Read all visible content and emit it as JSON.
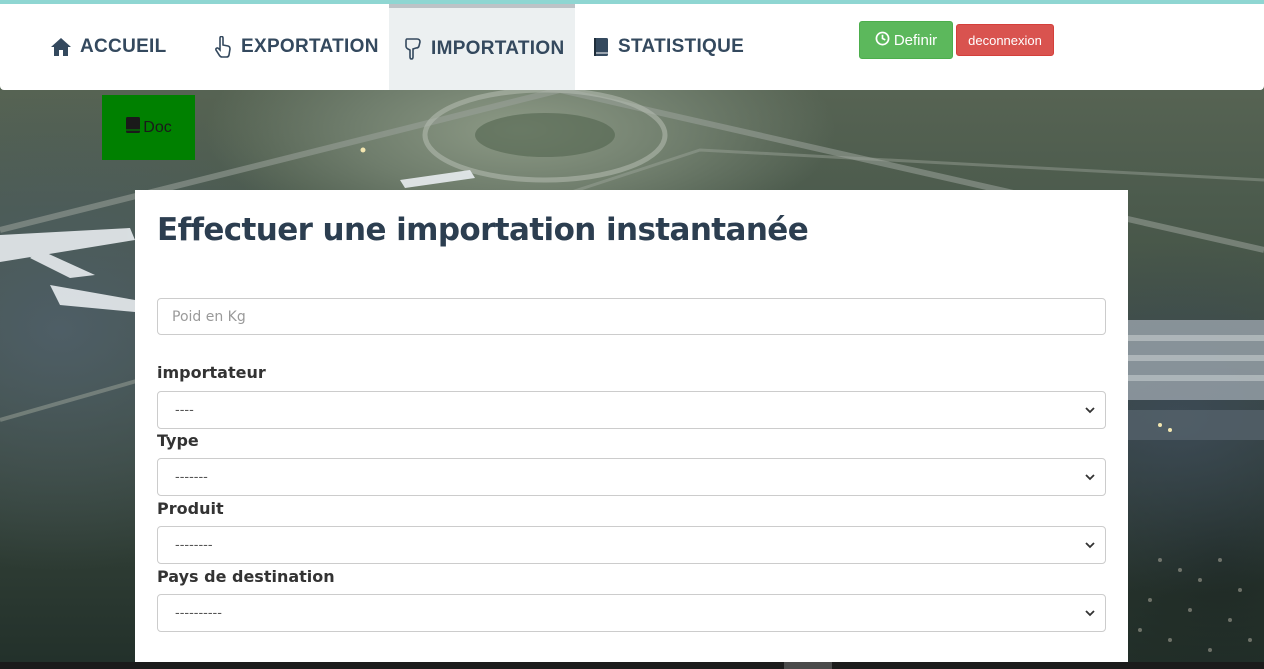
{
  "nav": {
    "items": [
      {
        "label": "ACCUEIL",
        "icon": "home-icon"
      },
      {
        "label": "EXPORTATION",
        "icon": "hand-pointer-icon"
      },
      {
        "label": "IMPORTATION",
        "icon": "hand-pointer-down-icon"
      },
      {
        "label": "STATISTIQUE",
        "icon": "book-icon"
      }
    ],
    "active": "IMPORTATION"
  },
  "actions": {
    "definir_label": "Definir",
    "definir_icon": "clock-icon",
    "deconnexion_label": "deconnexion"
  },
  "doc": {
    "label": "Doc",
    "icon": "book-icon"
  },
  "form": {
    "title": "Effectuer une importation instantanée",
    "poid_placeholder": "Poid en Kg",
    "poid_value": "",
    "fields": [
      {
        "label": "importateur",
        "selected": "----"
      },
      {
        "label": "Type",
        "selected": "-------"
      },
      {
        "label": "Produit",
        "selected": "--------"
      },
      {
        "label": "Pays de destination",
        "selected": "----------"
      }
    ]
  },
  "colors": {
    "nav_text": "#34495e",
    "active_nav_bg": "#ecf0f1",
    "definir_bg": "#5cb85c",
    "deconnexion_bg": "#d9534f",
    "doc_bg": "#008000",
    "top_strip": "#8fd6d2"
  }
}
